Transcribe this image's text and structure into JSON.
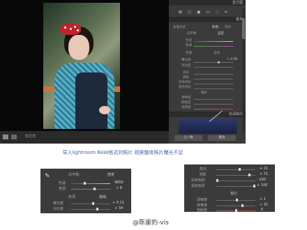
{
  "top_panel": {
    "header1": "直方图",
    "header_basic": "基本",
    "header_tone_curve": "色调曲线",
    "treatment_label": "处理方式",
    "treatment_options": [
      "彩色",
      "黑白"
    ],
    "wb_label": "白平衡",
    "wb_value": "自定",
    "temp_label": "色温",
    "tint_label": "色调",
    "tone_label": "色调",
    "auto_label": "自动",
    "exposure_label": "曝光度",
    "exposure_value": "+ 0.58",
    "contrast_label": "对比度",
    "rows": [
      "高光",
      "阴影",
      "白色色阶",
      "黑色色阶"
    ],
    "presence_label": "偏好",
    "presence_rows": [
      "清晰度",
      "鲜艳度",
      "饱和度"
    ],
    "prev_button": "上一张",
    "reset_button": "复位",
    "bottom_label": "软打样"
  },
  "caption": "导入lightroom  RAW格式的照片 观察整体照片曝光不足",
  "crop_left": {
    "treatment_label": "白平衡：",
    "treatment_value": "自定",
    "temp_label": "色温",
    "temp_value": "4850",
    "tint_label": "色调",
    "tint_value": "+ 8",
    "tone_label": "色调",
    "auto_label": "自动",
    "exposure_label": "曝光度",
    "exposure_value": "+ 0.11",
    "contrast_label": "对比度",
    "contrast_value": "+ 34"
  },
  "crop_right": {
    "rows": [
      {
        "label": "高光",
        "value": "+ 21"
      },
      {
        "label": "阴影",
        "value": "+ 71"
      },
      {
        "label": "白色色阶",
        "value": "- 100"
      },
      {
        "label": "黑色色阶",
        "value": "+ 100"
      }
    ],
    "presence_label": "偏好",
    "presence_rows": [
      {
        "label": "清晰度",
        "value": "+ 1"
      },
      {
        "label": "鲜艳度",
        "value": "+ 31"
      },
      {
        "label": "饱和度",
        "value": "0"
      }
    ]
  },
  "watermark": "@陈雷豹-vis"
}
